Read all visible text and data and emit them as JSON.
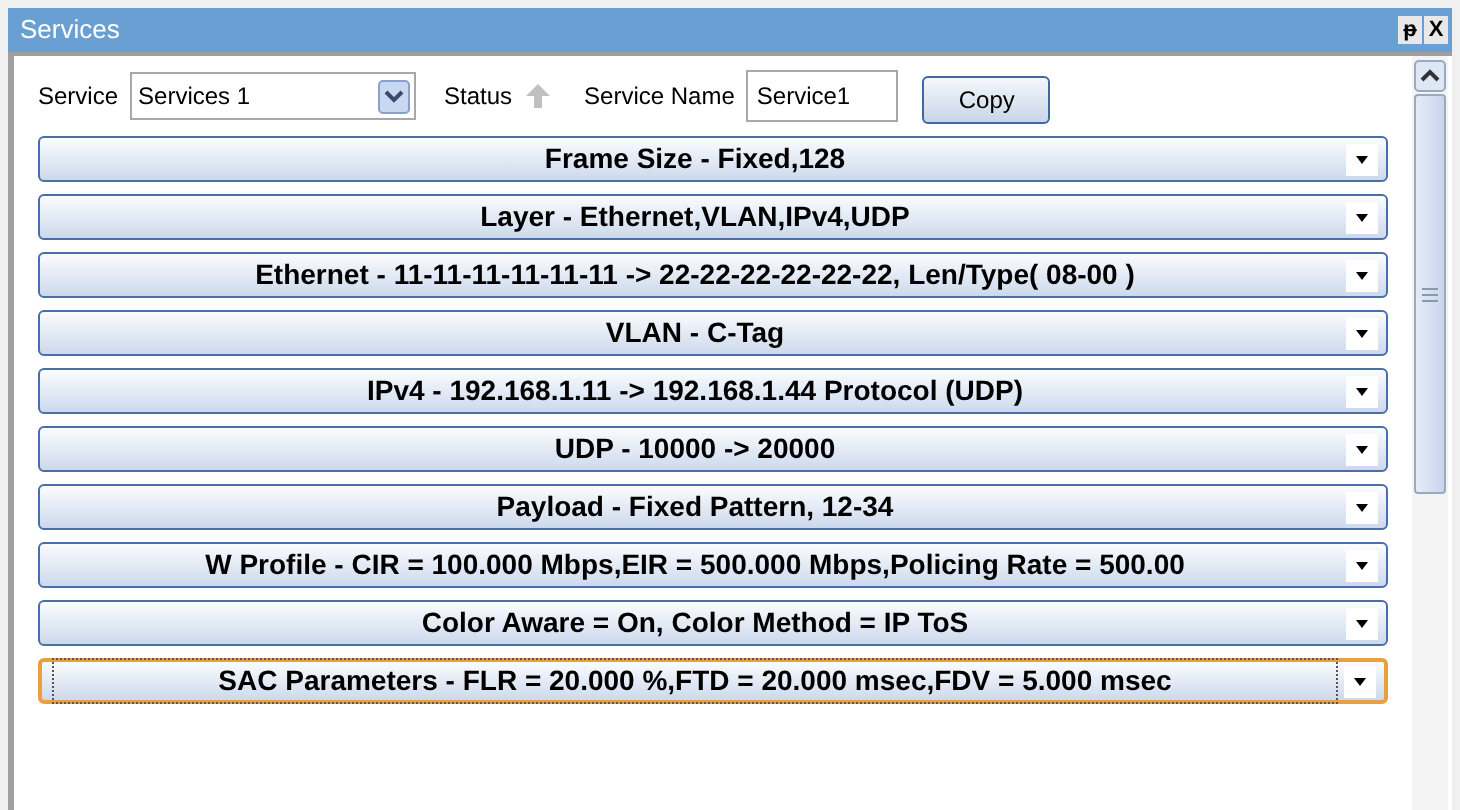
{
  "window": {
    "title": "Services",
    "buttons": [
      "ᵽ",
      "X"
    ]
  },
  "toolbar": {
    "service_label": "Service",
    "service_value": "Services 1",
    "status_label": "Status",
    "name_label": "Service Name",
    "name_value": "Service1",
    "copy_button": "Copy"
  },
  "sections": [
    {
      "label": "Frame Size - Fixed,128",
      "focused": false
    },
    {
      "label": "Layer - Ethernet,VLAN,IPv4,UDP",
      "focused": false
    },
    {
      "label": "Ethernet - 11-11-11-11-11-11 -> 22-22-22-22-22-22, Len/Type( 08-00 )",
      "focused": false
    },
    {
      "label": "VLAN - C-Tag",
      "focused": false
    },
    {
      "label": "IPv4 - 192.168.1.11 -> 192.168.1.44 Protocol (UDP)",
      "focused": false
    },
    {
      "label": "UDP - 10000 -> 20000",
      "focused": false
    },
    {
      "label": "Payload - Fixed Pattern, 12-34",
      "focused": false
    },
    {
      "label": "W Profile - CIR = 100.000 Mbps,EIR = 500.000 Mbps,Policing Rate = 500.00",
      "focused": false
    },
    {
      "label": "Color Aware = On, Color Method = IP ToS",
      "focused": false
    },
    {
      "label": "SAC Parameters - FLR = 20.000 %,FTD = 20.000 msec,FDV = 5.000 msec",
      "focused": true
    }
  ]
}
